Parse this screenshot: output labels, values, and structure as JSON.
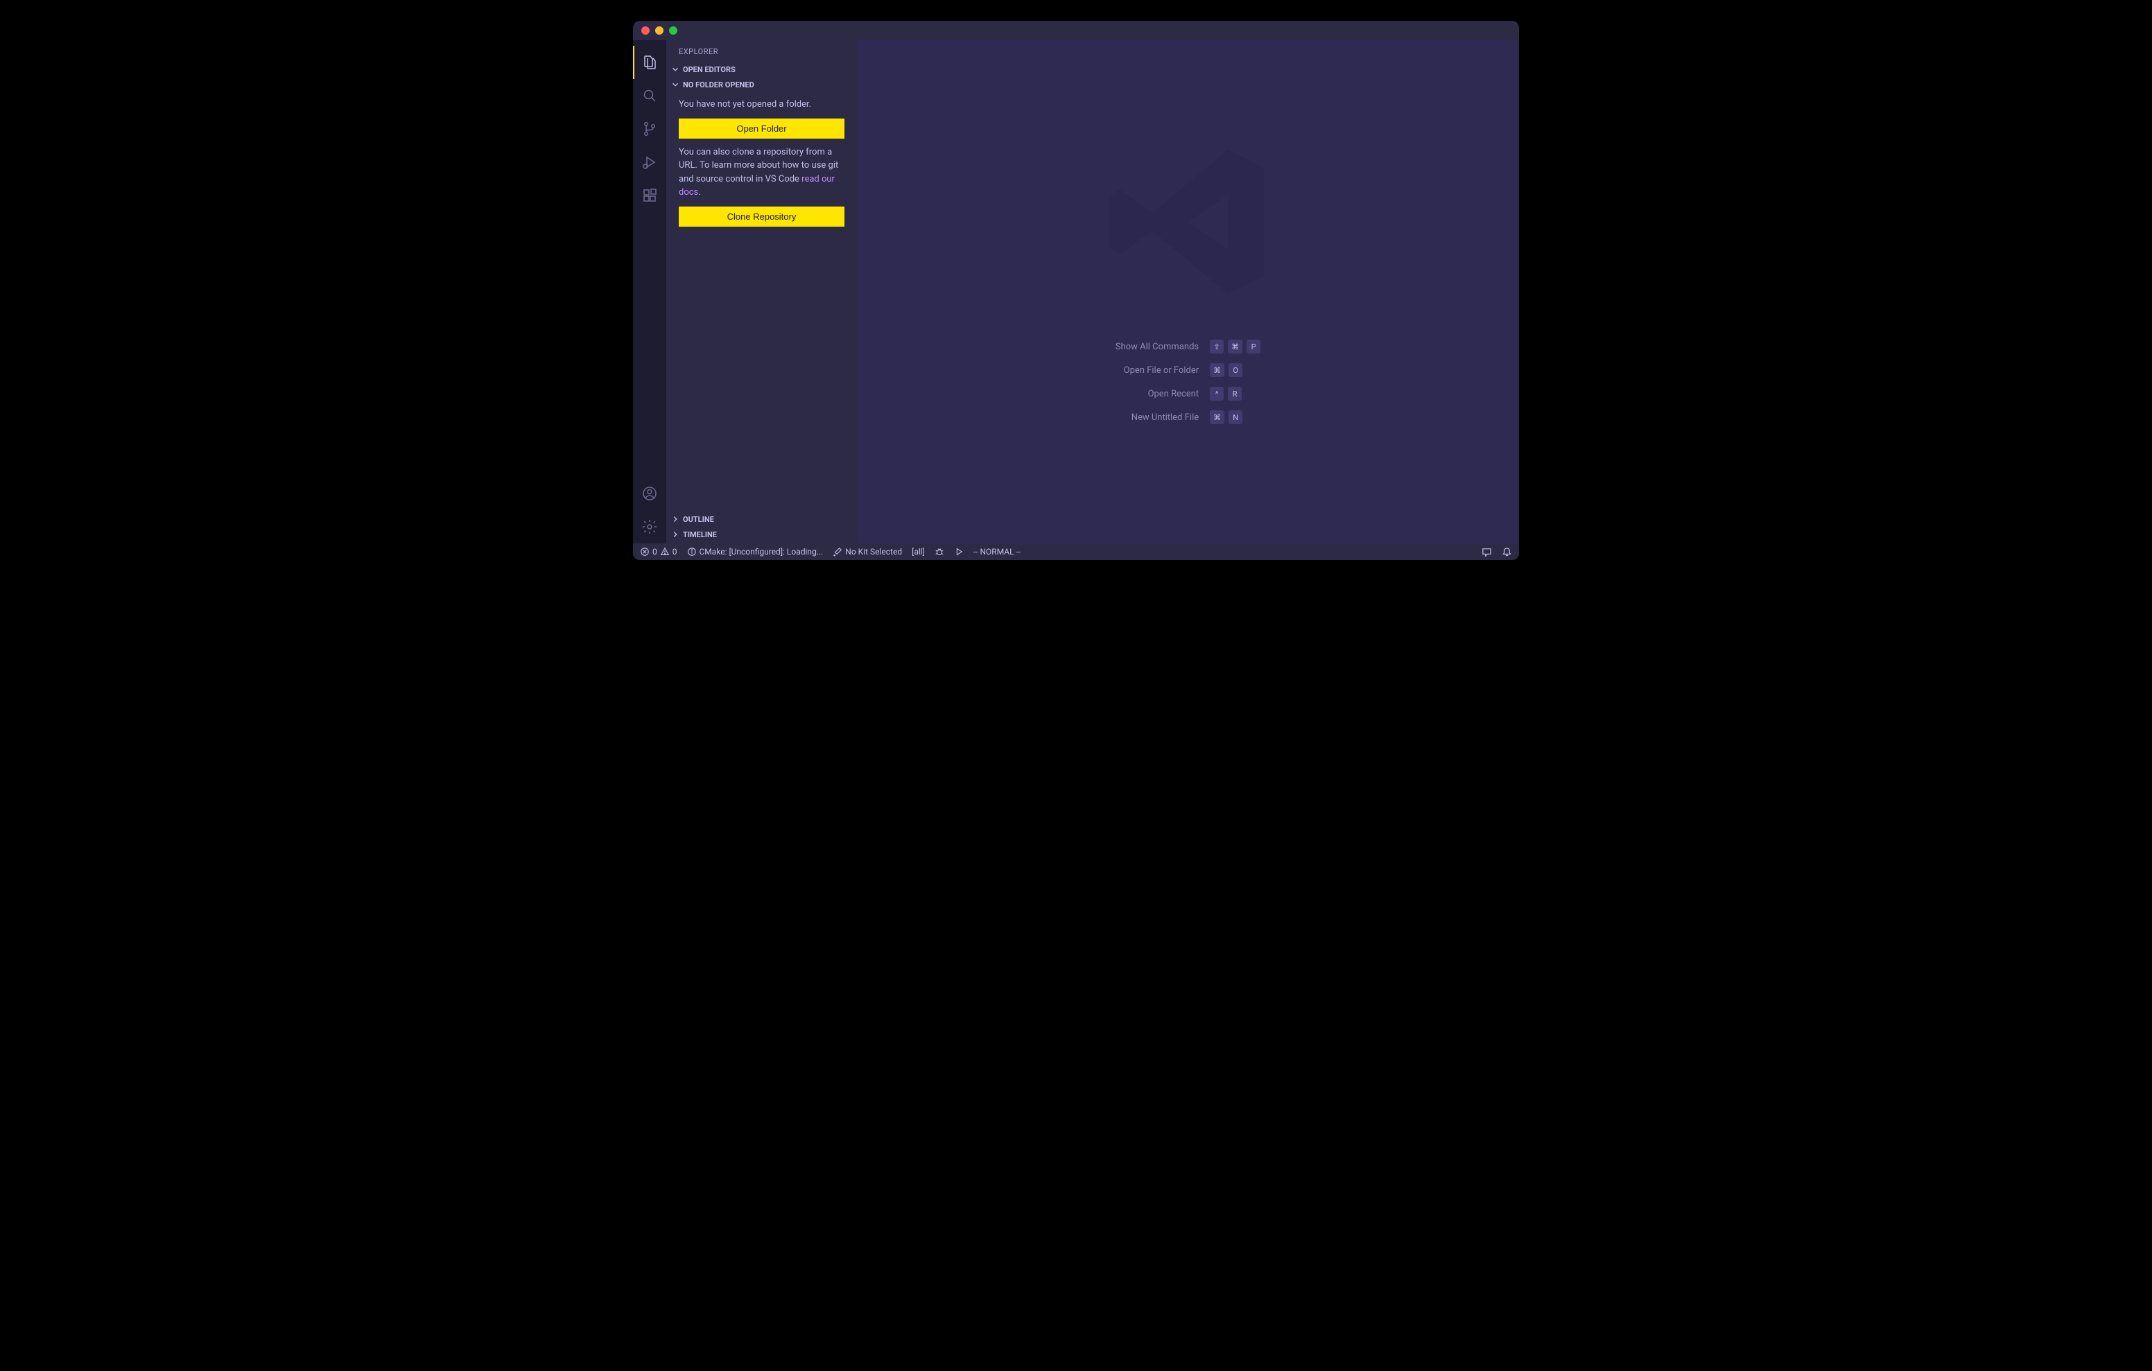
{
  "traffic": {
    "close": "#ff5f57",
    "min": "#febc2e",
    "max": "#28c840"
  },
  "sidebar": {
    "title": "EXPLORER",
    "sections": {
      "open_editors": "OPEN EDITORS",
      "no_folder": "NO FOLDER OPENED",
      "outline": "OUTLINE",
      "timeline": "TIMELINE"
    },
    "no_folder_msg": "You have not yet opened a folder.",
    "open_folder_btn": "Open Folder",
    "clone_msg_1": "You can also clone a repository from a URL. To learn more about how to use git and source control in VS Code ",
    "clone_link": "read our docs",
    "clone_msg_2": ".",
    "clone_btn": "Clone Repository"
  },
  "shortcuts": [
    {
      "label": "Show All Commands",
      "keys": [
        "⇧",
        "⌘",
        "P"
      ]
    },
    {
      "label": "Open File or Folder",
      "keys": [
        "⌘",
        "O"
      ]
    },
    {
      "label": "Open Recent",
      "keys": [
        "^",
        "R"
      ]
    },
    {
      "label": "New Untitled File",
      "keys": [
        "⌘",
        "N"
      ]
    }
  ],
  "status": {
    "errors": "0",
    "warnings": "0",
    "cmake": "CMake: [Unconfigured]: Loading...",
    "kit": "No Kit Selected",
    "target": "[all]",
    "vim": "-- NORMAL --"
  }
}
